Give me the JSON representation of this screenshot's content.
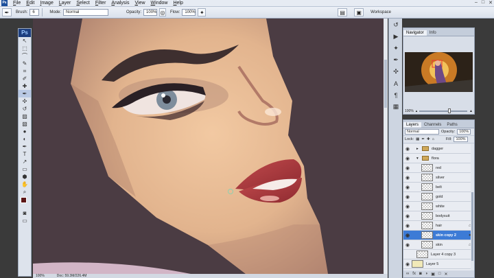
{
  "app": {
    "ps_mini": "Ps",
    "ps_logo": "Ps"
  },
  "menu": [
    "File",
    "Edit",
    "Image",
    "Layer",
    "Select",
    "Filter",
    "Analysis",
    "View",
    "Window",
    "Help"
  ],
  "window_controls": {
    "minimize": "–",
    "maximize": "□",
    "close": "✕"
  },
  "options": {
    "brush_label": "Brush:",
    "brush_size": "6",
    "mode_label": "Mode:",
    "mode_value": "Normal",
    "opacity_label": "Opacity:",
    "opacity_value": "100%",
    "flow_label": "Flow:",
    "flow_value": "100%",
    "workspace_label": "Workspace"
  },
  "tools": [
    "move-tool",
    "marquee-tool",
    "lasso-tool",
    "quick-select-tool",
    "crop-tool",
    "eyedropper-tool",
    "healing-tool",
    "brush-tool",
    "clone-stamp-tool",
    "history-brush-tool",
    "eraser-tool",
    "gradient-tool",
    "blur-tool",
    "dodge-tool",
    "pen-tool",
    "type-tool",
    "path-select-tool",
    "shape-tool",
    "3d-tool",
    "hand-tool",
    "zoom-tool"
  ],
  "tool_glyphs": [
    "↖",
    "⬚",
    "⌒",
    "✎",
    "⌗",
    "✐",
    "✚",
    "✒",
    "✣",
    "↺",
    "▨",
    "▧",
    "●",
    "◐",
    "✒",
    "T",
    "↗",
    "▭",
    "⬢",
    "✋",
    "⌕"
  ],
  "colors": {
    "foreground": "#5c1717",
    "background": "#ffffff",
    "canvas_bg": "#4b3c43",
    "selected_layer": "#3d7bd6"
  },
  "status": {
    "zoom": "100%",
    "doc": "Doc: 59.3M/226.4M"
  },
  "navigator": {
    "tabs": [
      "Navigator",
      "Info"
    ],
    "zoom": "100%"
  },
  "layers_panel": {
    "tabs": [
      "Layers",
      "Channels",
      "Paths"
    ],
    "blend_mode": "Normal",
    "opacity_label": "Opacity:",
    "opacity_value": "100%",
    "lock_label": "Lock:",
    "fill_label": "Fill:",
    "fill_value": "100%",
    "layers": [
      {
        "name": "dagger",
        "type": "group",
        "indent": 1,
        "visible": true,
        "expanded": false
      },
      {
        "name": "flora",
        "type": "group",
        "indent": 1,
        "visible": true,
        "expanded": true
      },
      {
        "name": "red",
        "type": "layer",
        "indent": 2,
        "visible": true
      },
      {
        "name": "silver",
        "type": "layer",
        "indent": 2,
        "visible": true
      },
      {
        "name": "belt",
        "type": "layer",
        "indent": 2,
        "visible": true
      },
      {
        "name": "gold",
        "type": "layer",
        "indent": 2,
        "visible": true
      },
      {
        "name": "white",
        "type": "layer",
        "indent": 2,
        "visible": true
      },
      {
        "name": "bodysuit",
        "type": "layer",
        "indent": 2,
        "visible": true
      },
      {
        "name": "hair",
        "type": "layer",
        "indent": 2,
        "visible": true,
        "locked": true
      },
      {
        "name": "skin copy 2",
        "type": "layer",
        "indent": 2,
        "visible": true,
        "selected": true
      },
      {
        "name": "skin",
        "type": "layer",
        "indent": 2,
        "visible": true,
        "locked": true
      },
      {
        "name": "Layer 4 copy 3",
        "type": "layer",
        "indent": 1,
        "visible": false
      },
      {
        "name": "Layer 5",
        "type": "layer",
        "indent": 0,
        "visible": true
      }
    ],
    "footer_icons": [
      "link-icon",
      "fx-icon",
      "mask-icon",
      "adjustment-icon",
      "folder-icon",
      "new-layer-icon",
      "trash-icon"
    ],
    "footer_glyphs": [
      "∞",
      "fx",
      "◙",
      "◑",
      "▣",
      "□",
      "✕"
    ]
  }
}
